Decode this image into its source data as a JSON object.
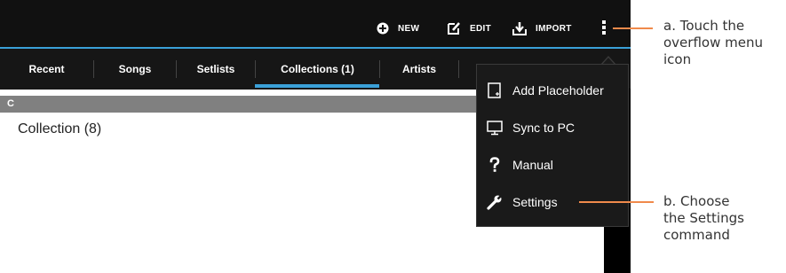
{
  "actionbar": {
    "new_label": "NEW",
    "edit_label": "EDIT",
    "import_label": "IMPORT"
  },
  "tabs": [
    {
      "label": "Recent"
    },
    {
      "label": "Songs"
    },
    {
      "label": "Setlists"
    },
    {
      "label": "Collections (1)"
    },
    {
      "label": "Artists"
    }
  ],
  "section": {
    "letter": "C"
  },
  "list": {
    "items": [
      "Collection (8)"
    ]
  },
  "overflow_menu": {
    "items": [
      {
        "label": "Add Placeholder",
        "icon": "placeholder-icon"
      },
      {
        "label": "Sync to PC",
        "icon": "monitor-icon"
      },
      {
        "label": "Manual",
        "icon": "question-icon"
      },
      {
        "label": "Settings",
        "icon": "wrench-icon"
      }
    ]
  },
  "annotations": {
    "a": [
      "a. Touch the",
      "overflow menu",
      "icon"
    ],
    "b": [
      "b. Choose",
      "the Settings",
      "command"
    ]
  },
  "colors": {
    "accent": "#3aa0d8",
    "callout": "#f08a4b",
    "bar": "#111111"
  }
}
